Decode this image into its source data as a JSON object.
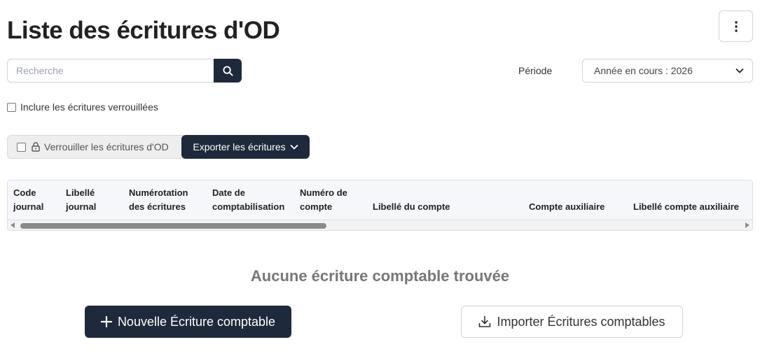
{
  "page": {
    "title": "Liste des écritures d'OD"
  },
  "toolbar": {
    "more_icon": "vertical-ellipsis-icon"
  },
  "search": {
    "placeholder": "Recherche",
    "value": "",
    "icon": "search-icon"
  },
  "periode": {
    "label": "Période",
    "selected": "Année en cours : 2026"
  },
  "filters": {
    "include_locked_label": "Inclure les écritures verrouillées",
    "include_locked_checked": false
  },
  "actions": {
    "lock_label": "Verrouiller les écritures d'OD",
    "lock_checked": false,
    "export_label": "Exporter les écritures"
  },
  "table": {
    "columns": [
      "Code journal",
      "Libellé journal",
      "Numérotation des écritures",
      "Date de comptabilisation",
      "Numéro de compte",
      "Libellé du compte",
      "Compte auxiliaire",
      "Libellé compte auxiliaire"
    ],
    "rows": []
  },
  "empty_state": {
    "message": "Aucune écriture comptable trouvée",
    "new_label": "Nouvelle Écriture comptable",
    "import_label": "Importer Écritures comptables"
  },
  "colors": {
    "primary": "#1e293b",
    "muted_text": "#777777",
    "table_header_bg": "#f6f7fb"
  }
}
